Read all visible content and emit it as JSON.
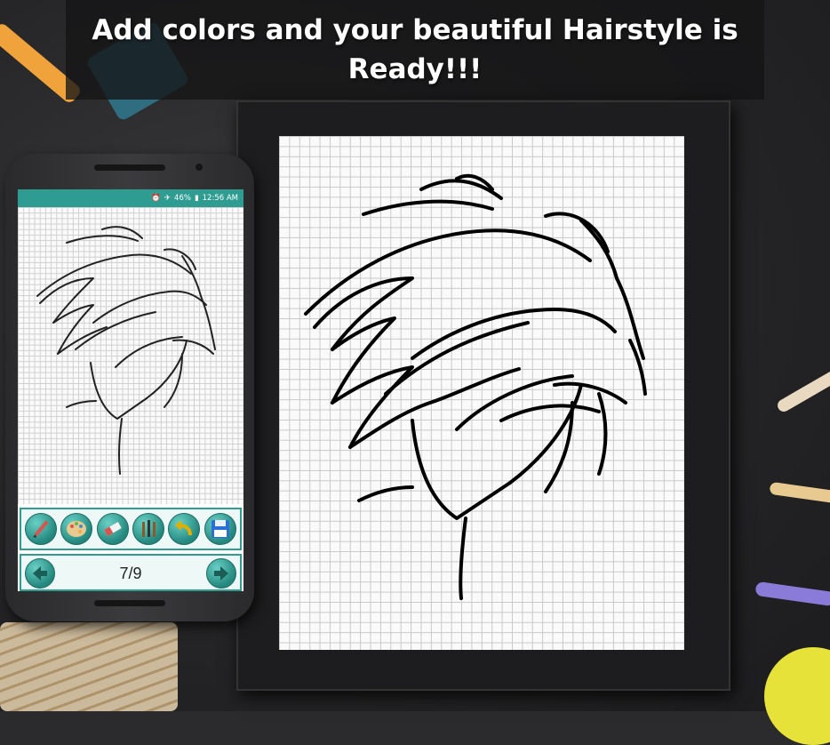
{
  "header": {
    "title": "Add colors and your beautiful Hairstyle is\nReady!!!"
  },
  "phone": {
    "status_bar": {
      "battery": "46%",
      "time": "12:56 AM"
    },
    "toolbar": {
      "tools": [
        "pencil-icon",
        "palette-icon",
        "eraser-icon",
        "brushes-icon",
        "undo-icon",
        "save-icon"
      ]
    },
    "navigation": {
      "page_counter": "7/9"
    }
  },
  "colors": {
    "accent": "#2f9c92",
    "toolbar_bg": "#eef8f7",
    "frame": "#1d1d1f"
  }
}
